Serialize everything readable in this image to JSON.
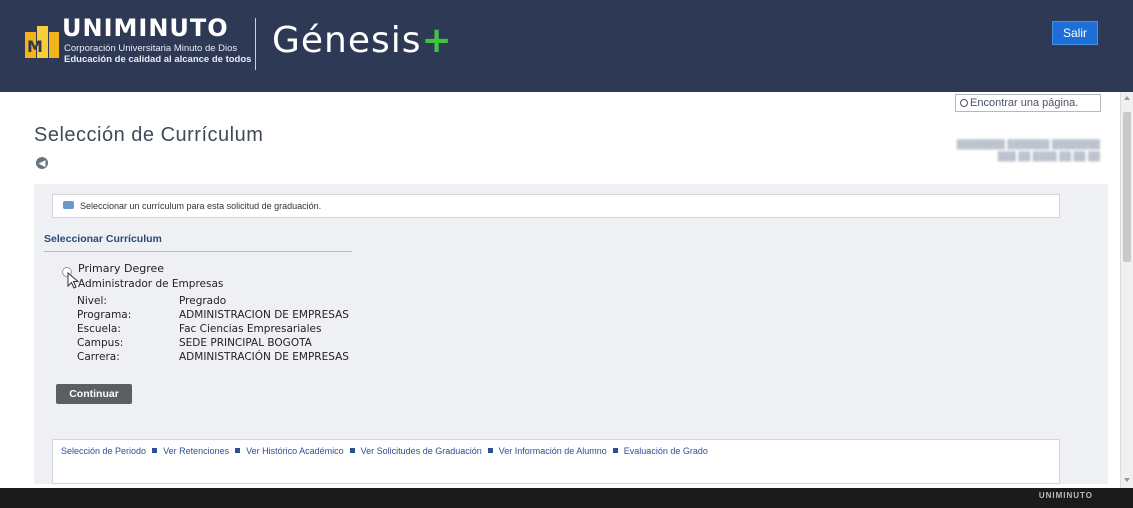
{
  "header": {
    "brand": "UNIMINUTO",
    "subtitle1": "Corporación Universitaria Minuto de Dios",
    "subtitle2": "Educación de calidad al alcance de todos",
    "app_name": "Génesis",
    "app_plus": "+",
    "logout_label": "Salir"
  },
  "search": {
    "placeholder": "Encontrar una página."
  },
  "page_title": "Selección de Currículum",
  "message": "Seleccionar un currículum para esta solicitud de graduación.",
  "section_title": "Seleccionar Currículum",
  "curriculum": {
    "degree": "Primary Degree",
    "program_name": "Administrador de Empresas",
    "fields": [
      {
        "label": "Nivel:",
        "value": "Pregrado"
      },
      {
        "label": "Programa:",
        "value": "ADMINISTRACION DE EMPRESAS"
      },
      {
        "label": "Escuela:",
        "value": "Fac Ciencias Empresariales"
      },
      {
        "label": "Campus:",
        "value": "SEDE PRINCIPAL BOGOTA"
      },
      {
        "label": "Carrera:",
        "value": "ADMINISTRACIÓN DE EMPRESAS"
      }
    ]
  },
  "continue_label": "Continuar",
  "links": [
    "Selección de Periodo",
    "Ver Retenciones",
    "Ver Histórico Académico",
    "Ver Solicitudes de Graduación",
    "Ver Información de Alumno",
    "Evaluación de Grado"
  ],
  "footer": {
    "brand": "UNIMINUTO"
  },
  "colors": {
    "header": "#2e3a55",
    "accent": "#1d6fd8",
    "plus": "#41c242",
    "link": "#2e4f92"
  }
}
